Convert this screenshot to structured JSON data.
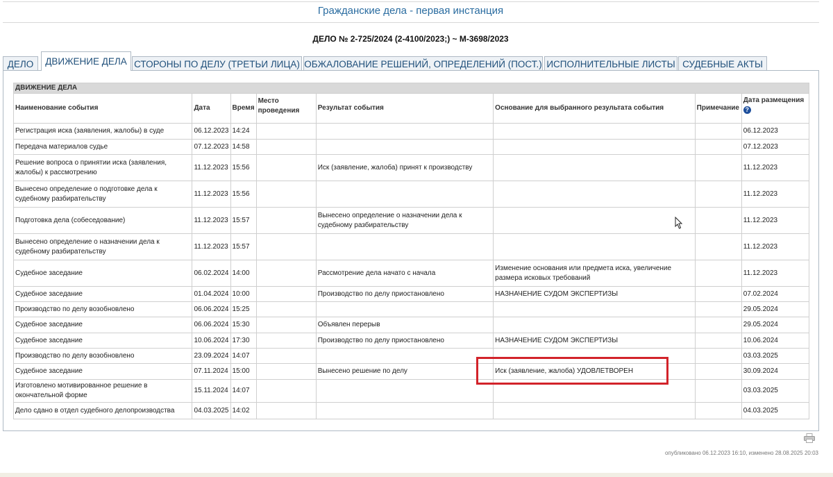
{
  "header": {
    "page_title": "Гражданские дела - первая инстанция",
    "case_title": "ДЕЛО № 2-725/2024 (2-4100/2023;) ~ М-3698/2023"
  },
  "tabs": [
    {
      "label": "ДЕЛО",
      "active": false
    },
    {
      "label": "ДВИЖЕНИЕ ДЕЛА",
      "active": true
    },
    {
      "label": "СТОРОНЫ ПО ДЕЛУ (ТРЕТЬИ ЛИЦА)",
      "active": false
    },
    {
      "label": "ОБЖАЛОВАНИЕ РЕШЕНИЙ, ОПРЕДЕЛЕНИЙ (ПОСТ.)",
      "active": false
    },
    {
      "label": "ИСПОЛНИТЕЛЬНЫЕ ЛИСТЫ",
      "active": false
    },
    {
      "label": "СУДЕБНЫЕ АКТЫ",
      "active": false
    }
  ],
  "table": {
    "section_title": "ДВИЖЕНИЕ ДЕЛА",
    "columns": {
      "event": "Наименование события",
      "date": "Дата",
      "time": "Время",
      "place": "Место проведения",
      "result": "Результат события",
      "basis": "Основание для выбранного результата события",
      "note": "Примечание",
      "posted": "Дата размещения"
    },
    "help_icon_glyph": "?",
    "rows": [
      {
        "event": "Регистрация иска (заявления, жалобы) в суде",
        "date": "06.12.2023",
        "time": "14:24",
        "place": "",
        "result": "",
        "basis": "",
        "note": "",
        "posted": "06.12.2023"
      },
      {
        "event": "Передача материалов судье",
        "date": "07.12.2023",
        "time": "14:58",
        "place": "",
        "result": "",
        "basis": "",
        "note": "",
        "posted": "07.12.2023"
      },
      {
        "event": "Решение вопроса о принятии иска (заявления, жалобы) к рассмотрению",
        "date": "11.12.2023",
        "time": "15:56",
        "place": "",
        "result": "Иск (заявление, жалоба) принят к производству",
        "basis": "",
        "note": "",
        "posted": "11.12.2023"
      },
      {
        "event": "Вынесено определение о подготовке дела к судебному разбирательству",
        "date": "11.12.2023",
        "time": "15:56",
        "place": "",
        "result": "",
        "basis": "",
        "note": "",
        "posted": "11.12.2023"
      },
      {
        "event": "Подготовка дела (собеседование)",
        "date": "11.12.2023",
        "time": "15:57",
        "place": "",
        "result": "Вынесено определение о назначении дела к судебному разбирательству",
        "basis": "",
        "note": "",
        "posted": "11.12.2023"
      },
      {
        "event": "Вынесено определение о назначении дела к судебному разбирательству",
        "date": "11.12.2023",
        "time": "15:57",
        "place": "",
        "result": "",
        "basis": "",
        "note": "",
        "posted": "11.12.2023"
      },
      {
        "event": "Судебное заседание",
        "date": "06.02.2024",
        "time": "14:00",
        "place": "",
        "result": "Рассмотрение дела начато с начала",
        "basis": "Изменение основания или предмета иска, увеличение размера исковых требований",
        "note": "",
        "posted": "11.12.2023"
      },
      {
        "event": "Судебное заседание",
        "date": "01.04.2024",
        "time": "10:00",
        "place": "",
        "result": "Производство по делу приостановлено",
        "basis": "НАЗНАЧЕНИЕ СУДОМ ЭКСПЕРТИЗЫ",
        "note": "",
        "posted": "07.02.2024"
      },
      {
        "event": "Производство по делу возобновлено",
        "date": "06.06.2024",
        "time": "15:25",
        "place": "",
        "result": "",
        "basis": "",
        "note": "",
        "posted": "29.05.2024"
      },
      {
        "event": "Судебное заседание",
        "date": "06.06.2024",
        "time": "15:30",
        "place": "",
        "result": "Объявлен перерыв",
        "basis": "",
        "note": "",
        "posted": "29.05.2024"
      },
      {
        "event": "Судебное заседание",
        "date": "10.06.2024",
        "time": "17:30",
        "place": "",
        "result": "Производство по делу приостановлено",
        "basis": "НАЗНАЧЕНИЕ СУДОМ ЭКСПЕРТИЗЫ",
        "note": "",
        "posted": "10.06.2024"
      },
      {
        "event": "Производство по делу возобновлено",
        "date": "23.09.2024",
        "time": "14:07",
        "place": "",
        "result": "",
        "basis": "",
        "note": "",
        "posted": "03.03.2025"
      },
      {
        "event": "Судебное заседание",
        "date": "07.11.2024",
        "time": "15:00",
        "place": "",
        "result": "Вынесено решение по делу",
        "basis": "Иск (заявление, жалоба) УДОВЛЕТВОРЕН",
        "note": "",
        "posted": "30.09.2024"
      },
      {
        "event": "Изготовлено мотивированное решение в окончательной форме",
        "date": "15.11.2024",
        "time": "14:07",
        "place": "",
        "result": "",
        "basis": "",
        "note": "",
        "posted": "03.03.2025"
      },
      {
        "event": "Дело сдано в отдел судебного делопроизводства",
        "date": "04.03.2025",
        "time": "14:02",
        "place": "",
        "result": "",
        "basis": "",
        "note": "",
        "posted": "04.03.2025"
      }
    ]
  },
  "footer": {
    "meta": "опубликовано 06.12.2023 16:10, изменено 28.08.2025 20:03",
    "print_icon": "printer-icon"
  },
  "colors": {
    "highlight": "#d2232a",
    "title": "#2a6ca0",
    "tab_text": "#1f4f7a"
  }
}
